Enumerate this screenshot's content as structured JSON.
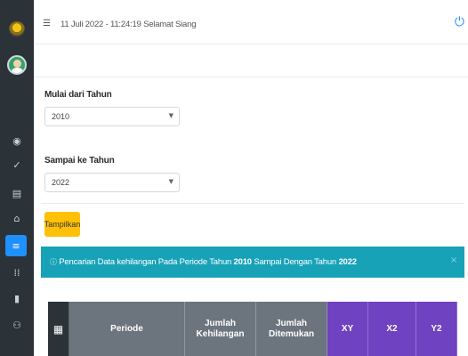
{
  "header": {
    "datetime_text": "11 Juli 2022 - 11:24:19 Selamat Siang",
    "menu_icon": "hamburger-icon",
    "power_icon": "power-icon"
  },
  "sidebar": {
    "logo_icon": "police-emblem-icon",
    "avatar_icon": "user-avatar-icon",
    "items": [
      {
        "icon": "dashboard-icon",
        "glyph": "◉",
        "active": false
      },
      {
        "icon": "check-icon",
        "glyph": "✓",
        "active": false
      },
      {
        "icon": "id-card-icon",
        "glyph": "▤",
        "active": false
      },
      {
        "icon": "inbox-icon",
        "glyph": "⌂",
        "active": false
      },
      {
        "icon": "list-icon",
        "glyph": "≡",
        "active": true
      },
      {
        "icon": "grid-icon",
        "glyph": "⁞⁞",
        "active": false
      },
      {
        "icon": "document-icon",
        "glyph": "▮",
        "active": false
      },
      {
        "icon": "users-icon",
        "glyph": "⚇",
        "active": false
      }
    ]
  },
  "form": {
    "start_label": "Mulai dari Tahun",
    "start_value": "2010",
    "end_label": "Sampai ke Tahun",
    "end_value": "2022",
    "submit_label": "Tampilkan"
  },
  "alert": {
    "icon": "info-icon",
    "prefix": "Pencarian Data kehilangan Pada Periode Tahun ",
    "year_from": "2010",
    "middle": " Sampai Dengan Tahun ",
    "year_to": "2022",
    "close": "×"
  },
  "table": {
    "icon": "qr-code-icon",
    "columns": [
      {
        "label": "Periode",
        "color": "gray"
      },
      {
        "label": "Jumlah Kehilangan",
        "color": "gray"
      },
      {
        "label": "Jumlah Ditemukan",
        "color": "gray"
      },
      {
        "label": "XY",
        "color": "purple"
      },
      {
        "label": "X2",
        "color": "purple"
      },
      {
        "label": "Y2",
        "color": "purple"
      }
    ]
  },
  "colors": {
    "sidebar": "#2b3238",
    "accent": "#1e90ff",
    "button": "#ffc107",
    "alert": "#17a2b8",
    "header_gray": "#6c757d",
    "header_purple": "#6f42c1"
  }
}
